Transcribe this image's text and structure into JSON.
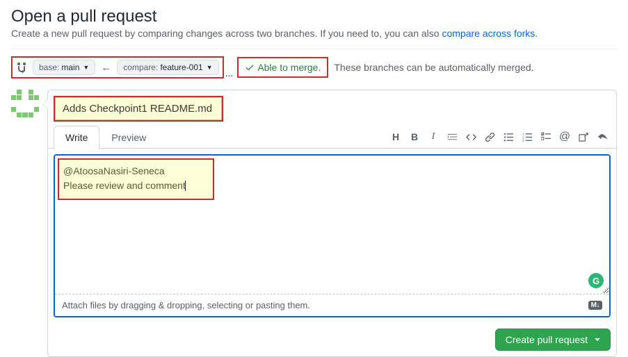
{
  "header": {
    "title": "Open a pull request",
    "subtitle_before": "Create a new pull request by comparing changes across two branches. If you need to, you can also ",
    "compare_link": "compare across forks",
    "subtitle_after": "."
  },
  "compare": {
    "base_label": "base:",
    "base_branch": "main",
    "compare_label": "compare:",
    "compare_branch": "feature-001",
    "ellipsis": "...",
    "merge_status": "Able to merge.",
    "merge_auto_text": "These branches can be automatically merged."
  },
  "pr": {
    "title_value": "Adds Checkpoint1 README.md",
    "comment_line1": "@AtoosaNasiri-Seneca",
    "comment_line2": "Please review and comment"
  },
  "tabs": {
    "write": "Write",
    "preview": "Preview"
  },
  "toolbar_icons": {
    "heading": "H",
    "bold": "B",
    "italic": "I",
    "quote": "quote",
    "code": "code",
    "link": "link",
    "ul": "ul",
    "ol": "ol",
    "task": "task",
    "mention": "@",
    "crossref": "crossref",
    "reply": "reply"
  },
  "attach": {
    "hint": "Attach files by dragging & dropping, selecting or pasting them.",
    "md_badge": "M↓"
  },
  "buttons": {
    "create": "Create pull request"
  }
}
